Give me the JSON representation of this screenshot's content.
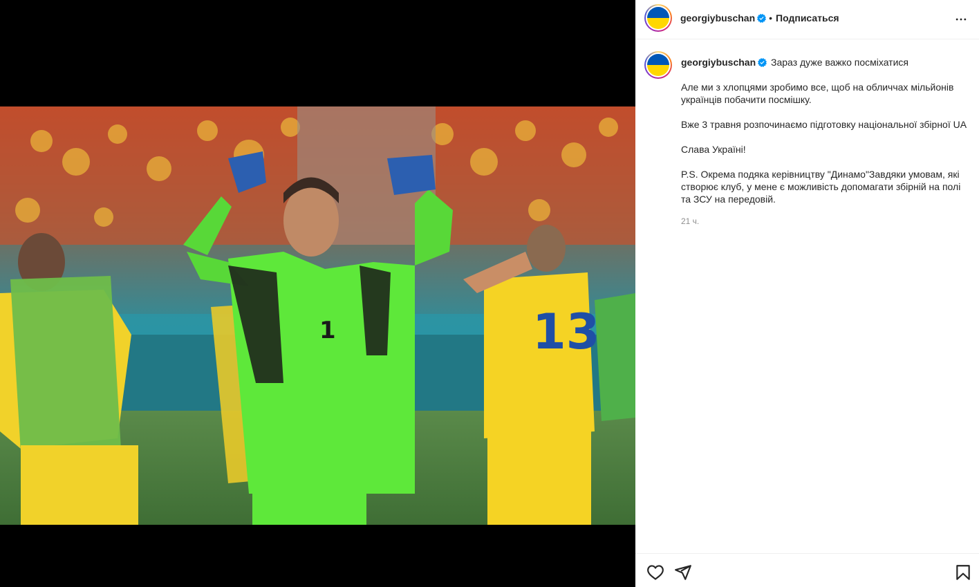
{
  "post": {
    "username": "georgiybuschan",
    "follow_label": "Подписаться",
    "separator": "•",
    "caption": {
      "username": "georgiybuschan",
      "headline": "Зараз дуже важко посміхатися",
      "paragraphs": [
        "Але ми з хлопцями зробимо все, щоб на обличчах мільйонів українців побачити посмішку.",
        "Вже 3 травня розпочинаємо підготовку національної збірної UA",
        "Слава Україні!",
        "P.S. Окрема подяка керівництву \"Динамо\"Завдяки умовам, які створює клуб, у мене є можливість допомагати збірній на полі та ЗСУ на передовій."
      ],
      "time": "21 ч."
    }
  },
  "icons": {
    "verified": "verified-badge-icon",
    "more": "more-options-icon",
    "like": "heart-icon",
    "share": "send-icon",
    "save": "bookmark-icon"
  },
  "colors": {
    "verified": "#0095f6",
    "flag_blue": "#0057b7",
    "flag_yellow": "#ffd700"
  }
}
